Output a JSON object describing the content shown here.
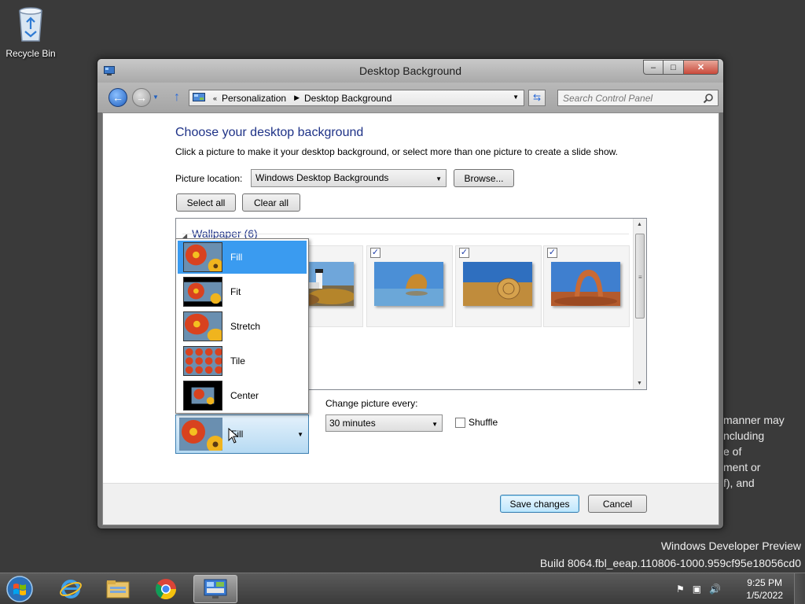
{
  "desktop": {
    "recycle_bin_label": "Recycle Bin",
    "watermark_line1": "Windows Developer Preview",
    "watermark_line2": "Build 8064.fbl_eeap.110806-1000.959cf95e18056cd0",
    "behind_window_text": [
      "manner may",
      "ncluding",
      "e of",
      "ment or",
      "f), and"
    ]
  },
  "window": {
    "title": "Desktop Background",
    "caption": {
      "minimize": "–",
      "maximize": "□",
      "close": "✕"
    }
  },
  "navbar": {
    "breadcrumb_prefix": "«",
    "breadcrumb": [
      "Personalization",
      "Desktop Background"
    ],
    "search_placeholder": "Search Control Panel"
  },
  "page": {
    "heading": "Choose your desktop background",
    "description": "Click a picture to make it your desktop background, or select more than one picture to create a slide show.",
    "picture_location_label": "Picture location:",
    "picture_location_value": "Windows Desktop Backgrounds",
    "browse_label": "Browse...",
    "select_all_label": "Select all",
    "clear_all_label": "Clear all"
  },
  "gallery": {
    "group_title": "Wallpaper (6)",
    "thumbnails": [
      {
        "name": "lighthouse",
        "checked": true
      },
      {
        "name": "rock-arch-water",
        "checked": true
      },
      {
        "name": "hay-bale",
        "checked": true
      },
      {
        "name": "delicate-arch",
        "checked": true
      }
    ]
  },
  "picture_position": {
    "options": [
      "Fill",
      "Fit",
      "Stretch",
      "Tile",
      "Center"
    ],
    "selected": "Fill",
    "current_value": "Fill"
  },
  "slideshow": {
    "change_every_label": "Change picture every:",
    "interval_value": "30 minutes",
    "shuffle_label": "Shuffle",
    "shuffle_checked": false
  },
  "footer": {
    "save_label": "Save changes",
    "cancel_label": "Cancel"
  },
  "taskbar": {
    "apps": [
      "internet-explorer",
      "file-explorer",
      "chrome",
      "control-panel"
    ],
    "active_app": "control-panel",
    "time": "9:25 PM",
    "date": "1/5/2022"
  },
  "colors": {
    "heading_blue": "#1e3287",
    "selection_blue": "#3a9bf0",
    "desktop_bg": "#3a3a3a"
  }
}
